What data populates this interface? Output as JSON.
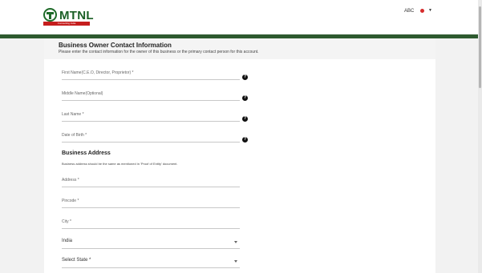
{
  "header": {
    "logo_text": "MTNL",
    "logo_tagline": "Connecting India",
    "user_name": "ABC"
  },
  "form": {
    "title": "Business Owner Contact Information",
    "subtitle": "Please enter the contact information for the owner of this business or the primary contact person for this account.",
    "fields": {
      "first_name": "First Name(C.E.O, Director, Proprietor) *",
      "middle_name": "Middle Name(Optional)",
      "last_name": "Last Name *",
      "dob": "Date of Birth *"
    },
    "help_glyph": "?",
    "address_section": {
      "title": "Business Address",
      "note": "Business address should be the same as mentioned in 'Proof of Entity' document.",
      "fields": {
        "address": "Address *",
        "pincode": "Pincode *",
        "city": "City *"
      },
      "country_value": "India",
      "state_value": "Select State *"
    }
  },
  "icons": {
    "help": "question-circle-icon",
    "flag": "flag-icon",
    "dropdown": "chevron-down-icon"
  },
  "colors": {
    "brand_green": "#2e5a2f",
    "logo_red": "#c51d1d"
  }
}
